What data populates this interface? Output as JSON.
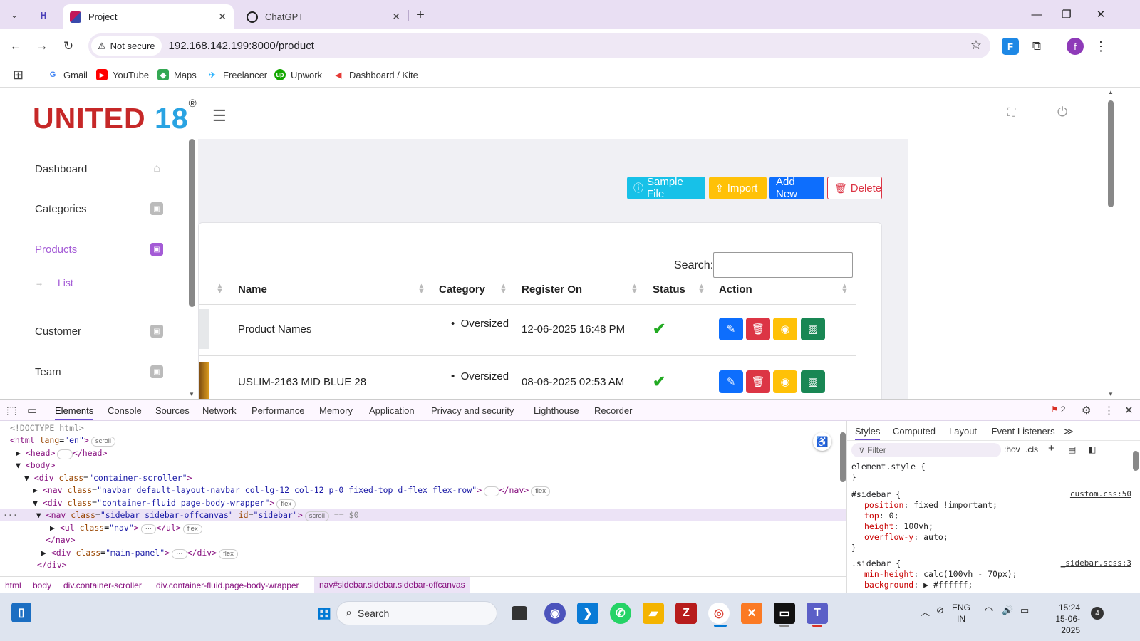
{
  "browser": {
    "tabs": [
      {
        "title": "Project",
        "active": true
      },
      {
        "title": "ChatGPT",
        "active": false
      }
    ],
    "address": {
      "security_label": "Not secure",
      "url": "192.168.142.199:8000/product"
    },
    "profile_initial": "f",
    "extension_label": "F",
    "bookmarks": [
      "Gmail",
      "YouTube",
      "Maps",
      "Freelancer",
      "Upwork",
      "Dashboard / Kite"
    ]
  },
  "app": {
    "logo_main": "UNITED",
    "logo_number": "18",
    "logo_mark": "®",
    "sidebar": {
      "items": [
        {
          "label": "Dashboard",
          "icon": "home-icon"
        },
        {
          "label": "Categories",
          "icon": "contact-book-icon"
        },
        {
          "label": "Products",
          "icon": "contact-book-icon",
          "active": true
        },
        {
          "label": "Customer",
          "icon": "contact-book-icon"
        },
        {
          "label": "Team",
          "icon": "contact-book-icon"
        }
      ],
      "subitem": "List"
    },
    "buttons": {
      "sample_file": "Sample File",
      "import": "Import",
      "add_new": "Add New",
      "delete": "Delete"
    },
    "search_label": "Search:",
    "table": {
      "columns": [
        "Name",
        "Category",
        "Register On",
        "Status",
        "Action"
      ],
      "rows": [
        {
          "name": "Product Names",
          "category": "Oversized",
          "registered": "12-06-2025 16:48 PM",
          "status": "active"
        },
        {
          "name": "USLIM-2163 MID BLUE 28",
          "category": "Oversized",
          "registered": "08-06-2025 02:53 AM",
          "status": "active"
        }
      ]
    },
    "colors": {
      "accent": "#a45bd6",
      "sample": "#17c1e8",
      "import": "#ffc107",
      "add": "#0d6efd",
      "delete": "#dc3545",
      "success": "#198754"
    }
  },
  "devtools": {
    "tabs": [
      "Elements",
      "Console",
      "Sources",
      "Network",
      "Performance",
      "Memory",
      "Application",
      "Privacy and security",
      "Lighthouse",
      "Recorder"
    ],
    "issues_count": "2",
    "dom": {
      "doctype": "<!DOCTYPE html>",
      "html_open": "<html",
      "html_lang_attr": "lang",
      "html_lang_val": "\"en\"",
      "head": "<head>",
      "head_close": "</head>",
      "body": "<body>",
      "div_scroller": "\"container-scroller\"",
      "nav_navbar": "\"navbar default-layout-navbar col-lg-12 col-12 p-0 fixed-top d-flex flex-row\"",
      "div_wrapper": "\"container-fluid page-body-wrapper\"",
      "nav_sidebar_class": "\"sidebar sidebar-offcanvas\"",
      "nav_sidebar_id": "\"sidebar\"",
      "ul_nav": "\"nav\"",
      "nav_close": "</nav>",
      "div_main": "\"main-panel\"",
      "div_close": "</div>",
      "dollar0": "== $0",
      "pill_scroll": "scroll",
      "pill_flex": "flex",
      "ellipsis": "···"
    },
    "styles_tabs": [
      "Styles",
      "Computed",
      "Layout",
      "Event Listeners"
    ],
    "filter_placeholder": "Filter",
    "hov_label": ":hov",
    "cls_label": ".cls",
    "css": {
      "element_style": "element.style {",
      "close": "}",
      "rule1_selector": "#sidebar {",
      "rule1_source": "custom.css:50",
      "rule1_props": [
        {
          "name": "position",
          "value": "fixed !important;"
        },
        {
          "name": "top",
          "value": "0;"
        },
        {
          "name": "height",
          "value": "100vh;"
        },
        {
          "name": "overflow-y",
          "value": "auto;"
        }
      ],
      "rule2_selector": ".sidebar {",
      "rule2_source": "_sidebar.scss:3",
      "rule2_props": [
        {
          "name": "min-height",
          "value": "calc(100vh - 70px);"
        },
        {
          "name": "background",
          "value": "▶ #ffffff;"
        }
      ]
    },
    "breadcrumbs": [
      "html",
      "body",
      "div.container-scroller",
      "div.container-fluid.page-body-wrapper",
      "nav#sidebar.sidebar.sidebar-offcanvas"
    ]
  },
  "taskbar": {
    "search_label": "Search",
    "language": "ENG",
    "region": "IN",
    "time": "15:24",
    "date": "15-06-2025",
    "notifications": "4"
  }
}
